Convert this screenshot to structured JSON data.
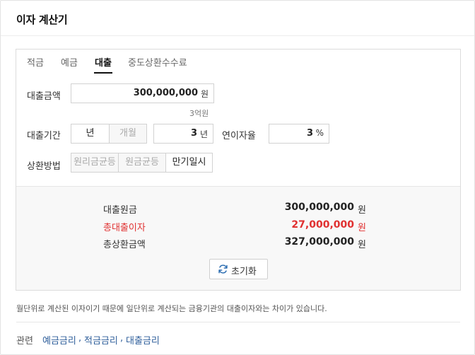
{
  "header": {
    "title": "이자 계산기"
  },
  "tabs": [
    {
      "label": "적금"
    },
    {
      "label": "예금"
    },
    {
      "label": "대출"
    },
    {
      "label": "중도상환수수료"
    }
  ],
  "form": {
    "amount": {
      "label": "대출금액",
      "value": "300,000,000",
      "unit": "원",
      "hint": "3억원"
    },
    "period": {
      "label": "대출기간",
      "unit_options": [
        "년",
        "개월"
      ],
      "selected_unit": "년",
      "value": "3",
      "unit": "년"
    },
    "rate": {
      "label": "연이자율",
      "value": "3",
      "unit": "%"
    },
    "method": {
      "label": "상환방법",
      "options": [
        "원리금균등",
        "원금균등",
        "만기일시"
      ],
      "selected": "만기일시"
    }
  },
  "result": {
    "principal": {
      "label": "대출원금",
      "value": "300,000,000",
      "unit": "원"
    },
    "interest": {
      "label": "총대출이자",
      "value": "27,000,000",
      "unit": "원"
    },
    "total": {
      "label": "총상환금액",
      "value": "327,000,000",
      "unit": "원"
    },
    "reset_label": "초기화"
  },
  "footer": {
    "note": "월단위로 계산된 이자이기 때문에 일단위로 계산되는 금융기관의 대출이자와는 차이가 있습니다.",
    "related_label": "관련",
    "related_links": [
      "예금금리",
      "적금금리",
      "대출금리"
    ],
    "separator": ","
  },
  "colors": {
    "accent_red": "#e03030",
    "link": "#2f5f9b"
  }
}
